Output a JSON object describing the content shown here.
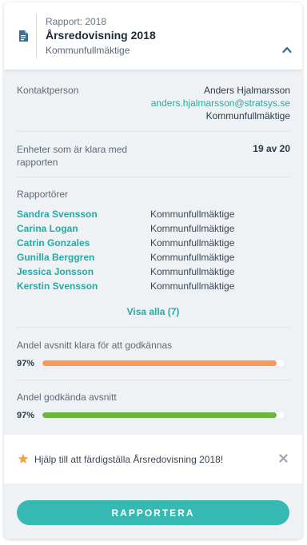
{
  "header": {
    "subtitle": "Rapport: 2018",
    "title": "Årsredovisning 2018",
    "organization": "Kommunfullmäktige"
  },
  "contact": {
    "label": "Kontaktperson",
    "name": "Anders Hjalmarsson",
    "email": "anders.hjalmarsson@stratsys.se",
    "organization": "Kommunfullmäktige"
  },
  "units": {
    "label": "Enheter som är klara med rapporten",
    "value": "19 av 20"
  },
  "reporters": {
    "label": "Rapportörer",
    "items": [
      {
        "name": "Sandra Svensson",
        "org": "Kommunfullmäktige"
      },
      {
        "name": "Carina Logan",
        "org": "Kommunfullmäktige"
      },
      {
        "name": "Catrin Gonzales",
        "org": "Kommunfullmäktige"
      },
      {
        "name": "Gunilla Berggren",
        "org": "Kommunfullmäktige"
      },
      {
        "name": "Jessica Jonsson",
        "org": "Kommunfullmäktige"
      },
      {
        "name": "Kerstin Svensson",
        "org": "Kommunfullmäktige"
      }
    ],
    "show_all": "Visa alla (7)"
  },
  "progress": [
    {
      "label": "Andel avsnitt klara för att godkännas",
      "percent_text": "97%",
      "value": 0.97,
      "color": "#f59a5c"
    },
    {
      "label": "Andel godkända avsnitt",
      "percent_text": "97%",
      "value": 0.97,
      "color": "#6cb53f"
    }
  ],
  "help": {
    "text": "Hjälp till att färdigställa Årsredovisning 2018!",
    "icon": "star-icon",
    "close_icon": "close-icon"
  },
  "action": {
    "label": "RAPPORTERA"
  },
  "colors": {
    "accent": "#36b8b3",
    "link": "#2aa8a3",
    "star": "#f0a640"
  }
}
